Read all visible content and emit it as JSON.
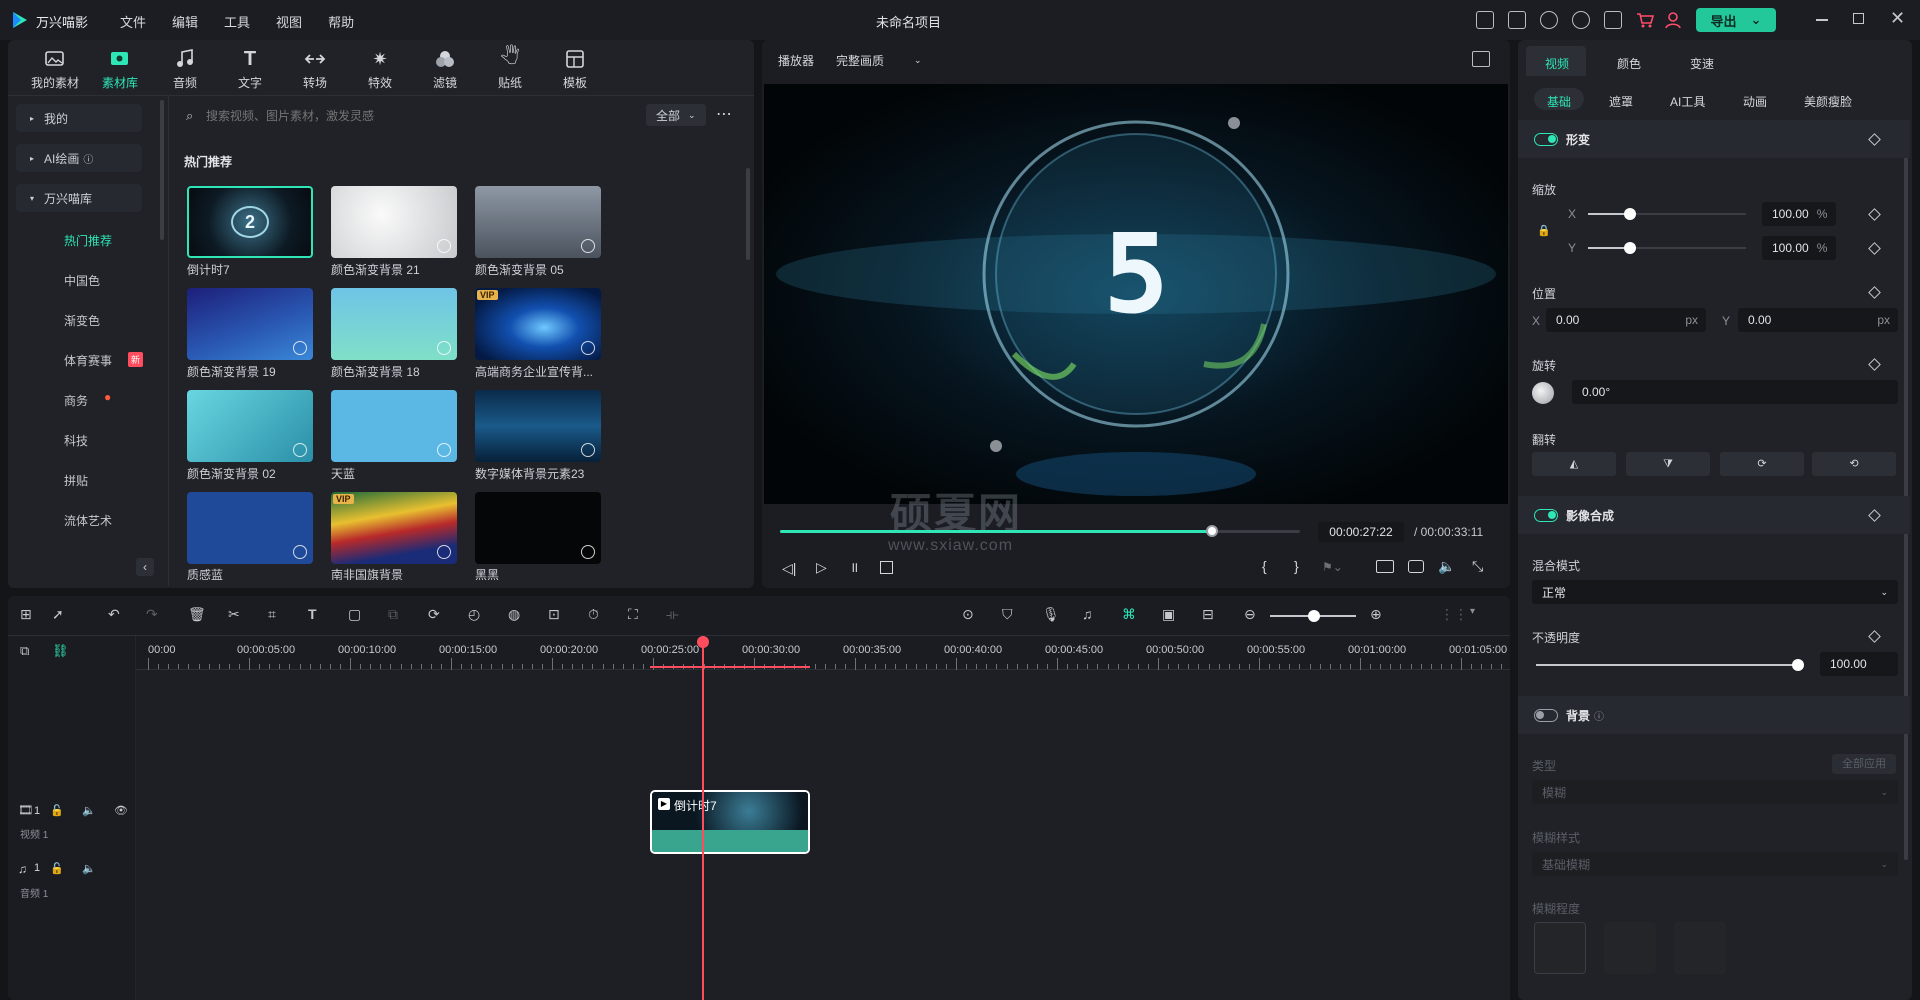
{
  "app": {
    "name": "万兴喵影",
    "project_title": "未命名项目",
    "menu": [
      "文件",
      "编辑",
      "工具",
      "视图",
      "帮助"
    ],
    "export_label": "导出",
    "accent": "#2ee6b6"
  },
  "toolbar": {
    "items": [
      {
        "label": "我的素材",
        "icon": "media-icon"
      },
      {
        "label": "素材库",
        "icon": "stock-icon",
        "active": true
      },
      {
        "label": "音频",
        "icon": "music-icon"
      },
      {
        "label": "文字",
        "icon": "text-icon"
      },
      {
        "label": "转场",
        "icon": "transition-icon"
      },
      {
        "label": "特效",
        "icon": "effects-icon"
      },
      {
        "label": "滤镜",
        "icon": "filter-icon"
      },
      {
        "label": "贴纸",
        "icon": "sticker-icon"
      },
      {
        "label": "模板",
        "icon": "template-icon"
      }
    ]
  },
  "sidebar": {
    "groups": [
      "我的",
      "AI绘画",
      "万兴喵库"
    ],
    "items": [
      "热门推荐",
      "中国色",
      "渐变色",
      "体育赛事",
      "商务",
      "科技",
      "拼贴",
      "流体艺术"
    ],
    "badge_new": "新"
  },
  "search": {
    "placeholder": "搜索视频、图片素材，激发灵感",
    "filter": "全部"
  },
  "library": {
    "section": "热门推荐",
    "items": [
      {
        "label": "倒计时7",
        "vip": false,
        "selected": true
      },
      {
        "label": "颜色渐变背景 21",
        "vip": false
      },
      {
        "label": "颜色渐变背景 05",
        "vip": false
      },
      {
        "label": "颜色渐变背景 19",
        "vip": false
      },
      {
        "label": "颜色渐变背景 18",
        "vip": false
      },
      {
        "label": "高端商务企业宣传背...",
        "vip": true
      },
      {
        "label": "颜色渐变背景 02",
        "vip": false
      },
      {
        "label": "天蓝",
        "vip": false
      },
      {
        "label": "数字媒体背景元素23",
        "vip": false
      },
      {
        "label": "质感蓝",
        "vip": false
      },
      {
        "label": "南非国旗背景",
        "vip": true
      },
      {
        "label": "黑黑",
        "vip": false
      }
    ],
    "vip_label": "VIP"
  },
  "player": {
    "label": "播放器",
    "quality": "完整画质",
    "countdown_digit": "5",
    "current_time": "00:00:27:22",
    "total_time": "/ 00:00:33:11",
    "progress": 0.83
  },
  "watermark": {
    "cn": "硕夏网",
    "url": "www.sxiaw.com"
  },
  "inspector": {
    "tabs": [
      "视频",
      "颜色",
      "变速"
    ],
    "subtabs": [
      "基础",
      "遮罩",
      "AI工具",
      "动画",
      "美颜瘦脸"
    ],
    "transform": {
      "title": "形变",
      "scale_label": "缩放",
      "x": "X",
      "y": "Y",
      "scale_x": "100.00",
      "scale_y": "100.00",
      "unit_pct": "%",
      "position_label": "位置",
      "pos_x": "0.00",
      "pos_y": "0.00",
      "unit_px": "px",
      "rotation_label": "旋转",
      "rotation": "0.00°",
      "flip_label": "翻转"
    },
    "compositing": {
      "title": "影像合成",
      "blend_label": "混合模式",
      "blend_value": "正常",
      "opacity_label": "不透明度",
      "opacity": "100.00"
    },
    "background": {
      "title": "背景",
      "type_label": "类型",
      "apply_all": "全部应用",
      "type_value": "模糊",
      "style_label": "模糊样式",
      "style_value": "基础模糊",
      "level_label": "模糊程度"
    }
  },
  "timeline": {
    "ruler": [
      "00:00",
      "00:00:05:00",
      "00:00:10:00",
      "00:00:15:00",
      "00:00:20:00",
      "00:00:25:00",
      "00:00:30:00",
      "00:00:35:00",
      "00:00:40:00",
      "00:00:45:00",
      "00:00:50:00",
      "00:00:55:00",
      "00:01:00:00",
      "00:01:05:00"
    ],
    "tracks": [
      {
        "num": "1",
        "name": "视频 1"
      },
      {
        "num": "1",
        "name": "音频 1"
      }
    ],
    "clip": {
      "label": "倒计时7"
    },
    "playhead_color": "#ff4d5e"
  }
}
